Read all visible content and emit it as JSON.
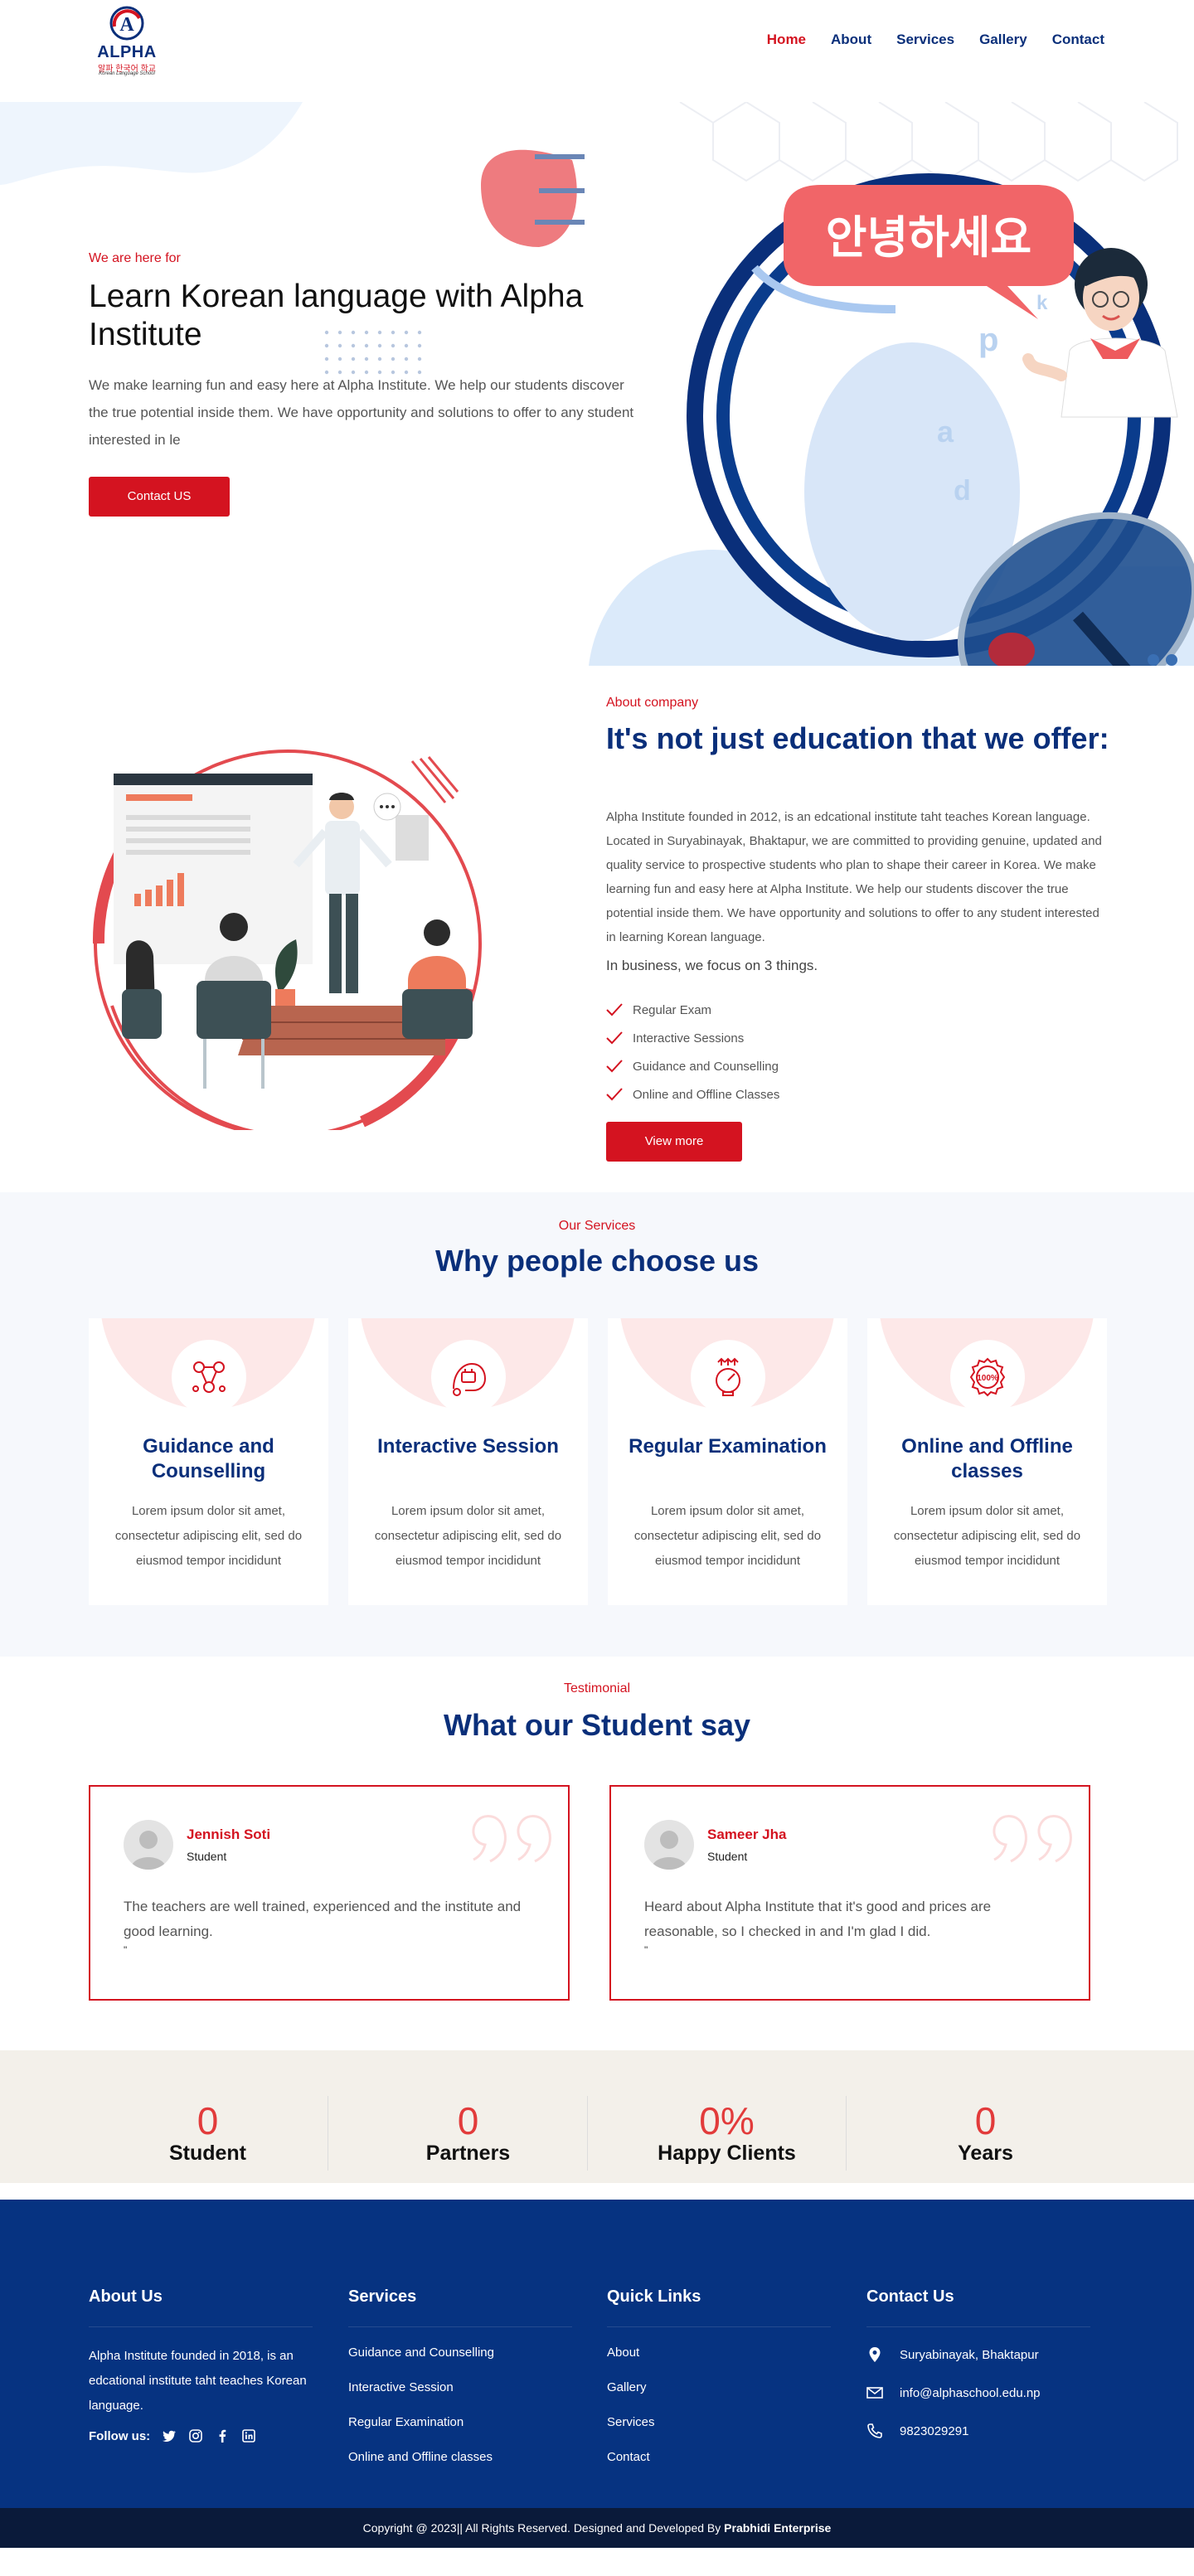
{
  "header": {
    "logo_text": "ALPHA",
    "logo_sub": "알파 한국어 학교",
    "logo_sub2": "Korean Language School",
    "nav": [
      "Home",
      "About",
      "Services",
      "Gallery",
      "Contact"
    ]
  },
  "hero": {
    "tag": "We are here for",
    "title": "Learn Korean language with Alpha Institute",
    "desc": "We make learning fun and easy here at Alpha Institute. We help our students discover the true potential inside them. We have opportunity and solutions to offer to any student interested in le",
    "button": "Contact US",
    "bubble_text": "안녕하세요"
  },
  "about": {
    "tag": "About company",
    "title": "It's not just education that we offer:",
    "desc": "Alpha Institute founded in 2012, is an edcational institute taht teaches Korean language. Located in Suryabinayak, Bhaktapur, we are committed to providing genuine, updated and quality service to prospective students who plan to shape their career in Korea. We make learning fun and easy here at Alpha Institute. We help our students discover the true potential inside them. We have opportunity and solutions to offer to any student interested in learning Korean language.",
    "focus": "In business, we focus on 3 things.",
    "list": [
      "Regular Exam",
      "Interactive Sessions",
      "Guidance and Counselling",
      "Online and Offline Classes"
    ],
    "button": "View more"
  },
  "services": {
    "tag": "Our Services",
    "title": "Why people choose us",
    "cards": [
      {
        "title": "Guidance and Counselling",
        "desc": "Lorem ipsum dolor sit amet, consectetur adipiscing elit, sed do eiusmod tempor incididunt",
        "icon": "guidance-icon"
      },
      {
        "title": "Interactive Session",
        "desc": "Lorem ipsum dolor sit amet, consectetur adipiscing elit, sed do eiusmod tempor incididunt",
        "icon": "interactive-icon"
      },
      {
        "title": "Regular Examination",
        "desc": "Lorem ipsum dolor sit amet, consectetur adipiscing elit, sed do eiusmod tempor incididunt",
        "icon": "exam-icon"
      },
      {
        "title": "Online and Offline classes",
        "desc": "Lorem ipsum dolor sit amet, consectetur adipiscing elit, sed do eiusmod tempor incididunt",
        "icon": "badge-icon"
      }
    ]
  },
  "testimonials": {
    "tag": "Testimonial",
    "title": "What our Student say",
    "items": [
      {
        "name": "Jennish Soti",
        "role": "Student",
        "text": "The teachers are well trained, experienced and the institute and good learning.",
        "mark": "\""
      },
      {
        "name": "Sameer Jha",
        "role": "Student",
        "text": "Heard about Alpha Institute that it's good and prices are reasonable, so I checked in and I'm glad I did.",
        "mark": "\""
      }
    ]
  },
  "counters": [
    {
      "num": "0",
      "label": "Student"
    },
    {
      "num": "0",
      "label": "Partners"
    },
    {
      "num": "0%",
      "label": "Happy Clients"
    },
    {
      "num": "0",
      "label": "Years"
    }
  ],
  "footer": {
    "about_title": "About Us",
    "about_text": "Alpha Institute founded in 2018, is an edcational institute taht teaches Korean language.",
    "follow": "Follow us:",
    "services_title": "Services",
    "services": [
      "Guidance and Counselling",
      "Interactive Session",
      "Regular Examination",
      "Online and Offline classes"
    ],
    "links_title": "Quick Links",
    "links": [
      "About",
      "Gallery",
      "Services",
      "Contact"
    ],
    "contact_title": "Contact Us",
    "address": "Suryabinayak, Bhaktapur",
    "email": "info@alphaschool.edu.np",
    "phone": "9823029291",
    "copyright": "Copyright @ 2023|| All Rights Reserved. Designed and Developed By",
    "developer": "Prabhidi Enterprise"
  },
  "colors": {
    "primary": "#0a2f7a",
    "accent": "#d41320",
    "footer": "#063381"
  }
}
